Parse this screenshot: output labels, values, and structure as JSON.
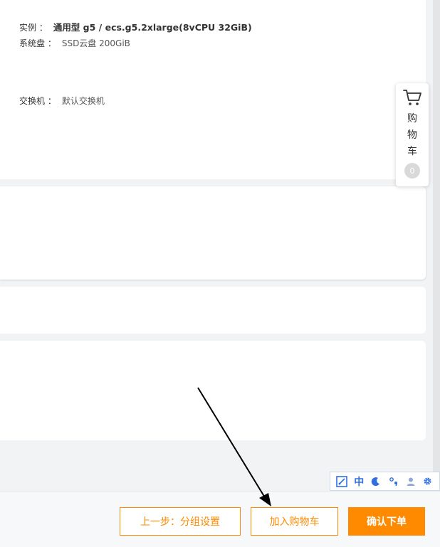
{
  "summary": {
    "instance": {
      "label": "实例 ：",
      "value": "通用型 g5 / ecs.g5.2xlarge(8vCPU 32GiB)"
    },
    "system_disk": {
      "label": "系统盘 ：",
      "value": "SSD云盘 200GiB"
    },
    "switch": {
      "label": "交换机 ：",
      "value": "默认交换机"
    }
  },
  "cart_widget": {
    "icon": "cart-icon",
    "label": "购物车",
    "count": "0"
  },
  "ime_toolbar": {
    "items": [
      "ime-logo-icon",
      "中",
      "moon-icon",
      "punctuation-icon",
      "user-icon",
      "gear-icon"
    ],
    "mode_label": "中",
    "accent": "#2f6fe0"
  },
  "footer": {
    "prev_label": "上一步：分组设置",
    "add_cart_label": "加入购物车",
    "confirm_label": "确认下单",
    "accent": "#ff8a00"
  },
  "annotation": {
    "type": "arrow",
    "color": "#000000"
  }
}
